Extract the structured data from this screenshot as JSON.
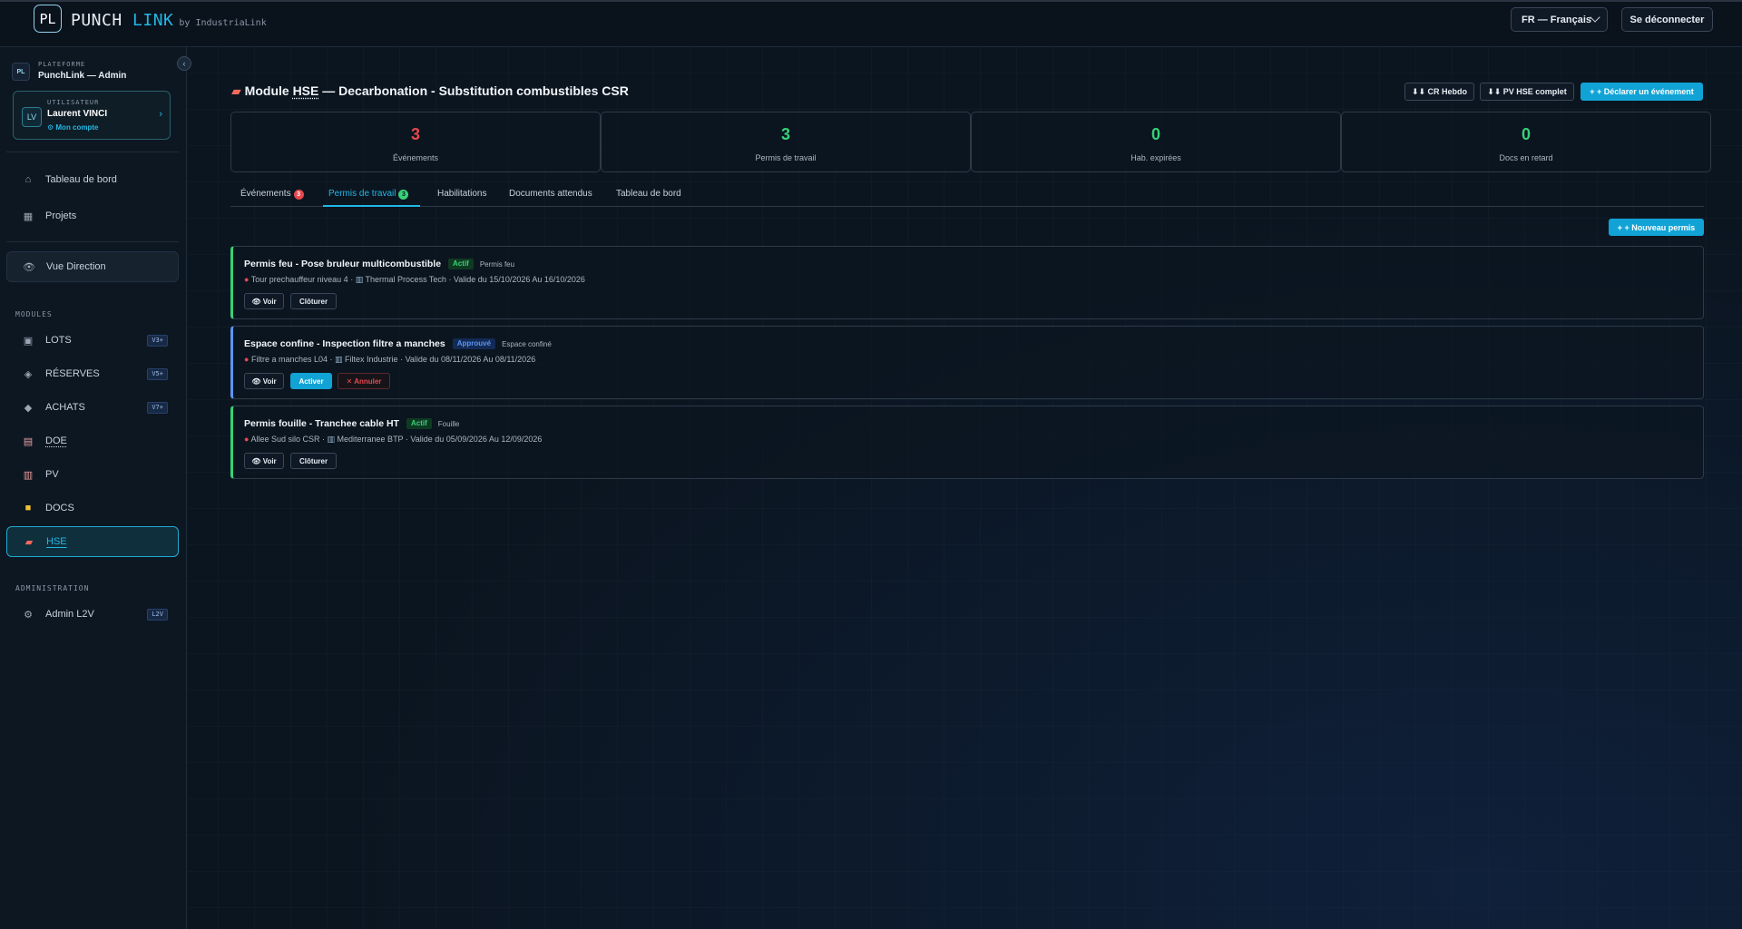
{
  "brand": {
    "logo_mark": "PL",
    "name_part1": "PUNCH",
    "name_part2": "LINK",
    "byline": "by IndustriaLink"
  },
  "topbar": {
    "language": "FR — Français",
    "logout": "Se déconnecter"
  },
  "sidebar": {
    "platform_badge": "PL",
    "platform_caption": "PLATEFORME",
    "platform_value": "PunchLink — Admin",
    "user_avatar": "LV",
    "user_caption": "UTILISATEUR",
    "user_name": "Laurent VINCI",
    "account_link": "⚙ Mon compte",
    "nav": [
      {
        "label": "Tableau de bord",
        "icon": "home-icon"
      },
      {
        "label": "Projets",
        "icon": "grid-icon"
      },
      {
        "label": "Vue Direction",
        "icon": "eye-icon"
      }
    ],
    "modules_caption": "MODULES",
    "modules": [
      {
        "label": "LOTS",
        "version": "V3+",
        "icon": "box-icon"
      },
      {
        "label": "RÉSERVES",
        "version": "V5+",
        "icon": "diamond-icon"
      },
      {
        "label": "ACHATS",
        "version": "V7+",
        "icon": "diamond-icon"
      },
      {
        "label": "DOE",
        "icon": "clipboard-icon"
      },
      {
        "label": "PV",
        "icon": "document-icon"
      },
      {
        "label": "DOCS",
        "icon": "folder-icon"
      },
      {
        "label": "HSE",
        "icon": "safety-vest-icon"
      }
    ],
    "admin_caption": "ADMINISTRATION",
    "admin": {
      "label": "Admin L2V",
      "version": "L2V",
      "icon": "gear-icon"
    }
  },
  "header": {
    "title_prefix": "Module ",
    "title_module": "HSE",
    "title_suffix": " — Decarbonation - Substitution combustibles CSR",
    "buttons": {
      "cr_hebdo": "⬇⬇ CR Hebdo",
      "pv_hse": "⬇⬇ PV HSE complet",
      "declare": "+ + Déclarer un événement"
    }
  },
  "stats": [
    {
      "value": "3",
      "label": "Événements",
      "color": "#e5484d"
    },
    {
      "value": "3",
      "label": "Permis de travail",
      "color": "#37d177"
    },
    {
      "value": "0",
      "label": "Hab. expirées",
      "color": "#37d177"
    },
    {
      "value": "0",
      "label": "Docs en retard",
      "color": "#37d177"
    }
  ],
  "tabs": [
    {
      "label": "Événements",
      "count": "3",
      "count_color": "#e5484d"
    },
    {
      "label": "Permis de travail",
      "count": "3",
      "count_color": "#37d177"
    },
    {
      "label": "Habilitations"
    },
    {
      "label": "Documents attendus"
    },
    {
      "label": "Tableau de bord"
    }
  ],
  "new_permit": "+ + Nouveau permis",
  "permits": [
    {
      "title": "Permis feu - Pose bruleur multicombustible",
      "status": "Actif",
      "type": "Permis feu",
      "location": "Tour prechauffeur niveau 4",
      "company": "Thermal Process Tech",
      "validity": "· Valide du 15/10/2026 Au 16/10/2026",
      "accent": "#37d177",
      "actions": [
        "👁 Voir",
        "Clôturer"
      ]
    },
    {
      "title": "Espace confine - Inspection filtre a manches",
      "status": "Approuvé",
      "type": "Espace confiné",
      "location": "Filtre a manches L04",
      "company": "Filtex Industrie",
      "validity": "· Valide du 08/11/2026 Au 08/11/2026",
      "accent": "#5b95f0",
      "actions": [
        "👁 Voir",
        "Activer",
        "✕ Annuler"
      ]
    },
    {
      "title": "Permis fouille - Tranchee cable HT",
      "status": "Actif",
      "type": "Fouille",
      "location": "Allee Sud silo CSR",
      "company": "Mediterranee BTP",
      "validity": "· Valide du 05/09/2026 Au 12/09/2026",
      "accent": "#37d177",
      "actions": [
        "👁 Voir",
        "Clôturer"
      ]
    }
  ]
}
